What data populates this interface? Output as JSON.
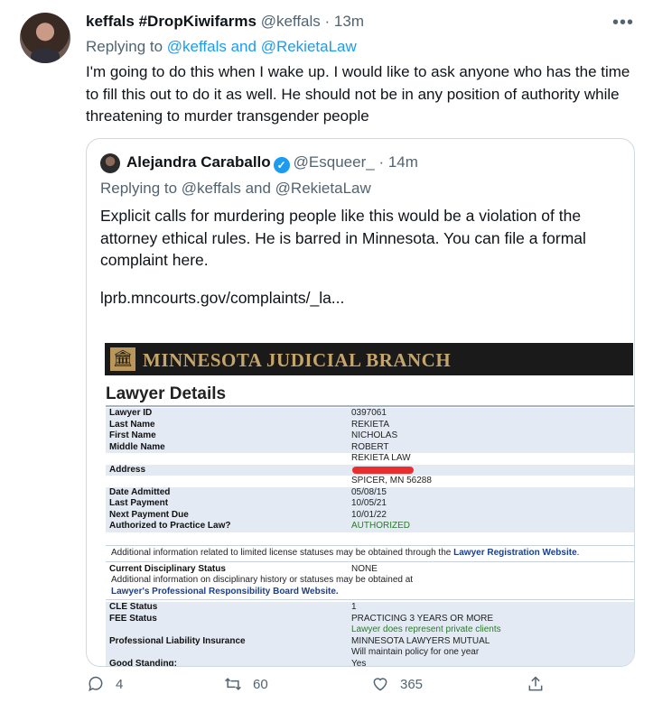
{
  "tweet": {
    "display_name": "keffals #DropKiwifarms",
    "handle": "@keffals",
    "dot": "·",
    "time": "13m",
    "replying_prefix": "Replying to",
    "replying_users": "@keffals and @RekietaLaw",
    "text": "I'm going to do this when I wake up. I would like to ask anyone who has the time to fill this out to do it as well. He should not be in any position of authority while threatening to murder transgender people",
    "more_icon": "ellipsis-icon"
  },
  "quote": {
    "display_name": "Alejandra Caraballo",
    "verified_glyph": "✓",
    "handle": "@Esqueer_",
    "dot": "·",
    "time": "14m",
    "replying": "Replying to @keffals and @RekietaLaw",
    "text": "Explicit calls for murdering people like this would be a violation of the attorney ethical rules. He is barred in Minnesota. You can file a formal complaint here.",
    "link": "lprb.mncourts.gov/complaints/_la..."
  },
  "document": {
    "banner_title": "MINNESOTA JUDICIAL BRANCH",
    "heading": "Lawyer Details",
    "rows": [
      {
        "label": "Lawyer ID",
        "value": "0397061"
      },
      {
        "label": "Last Name",
        "value": "REKIETA"
      },
      {
        "label": "First Name",
        "value": "NICHOLAS"
      },
      {
        "label": "Middle Name",
        "value": "ROBERT"
      }
    ],
    "address_label": "Address",
    "address_line1": "REKIETA LAW",
    "address_line3": "SPICER, MN  56288",
    "rows2": [
      {
        "label": "Date Admitted",
        "value": "05/08/15"
      },
      {
        "label": "Last Payment",
        "value": "10/05/21"
      },
      {
        "label": "Next Payment Due",
        "value": "10/01/22"
      }
    ],
    "authorized_label": "Authorized to Practice Law?",
    "authorized_value": "AUTHORIZED",
    "license_note_prefix": "Additional information related to limited license statuses may be obtained through the ",
    "license_note_link": "Lawyer Registration Website",
    "license_note_suffix": ".",
    "discipline_label": "Current Disciplinary Status",
    "discipline_value": "NONE",
    "discipline_note": "Additional information on disciplinary history or statuses may be obtained at",
    "discipline_link": "Lawyer's Professional Responsibility Board Website.",
    "cle_label": "CLE Status",
    "cle_value": "1",
    "fee_label": "FEE Status",
    "fee_value": "PRACTICING 3 YEARS OR MORE",
    "private_clients": "Lawyer does represent private clients",
    "insurance_label": "Professional Liability Insurance",
    "insurance_value": "MINNESOTA LAWYERS MUTUAL",
    "insurance_note": "Will maintain policy for one year",
    "standing_label": "Good Standing:",
    "standing_value": "Yes"
  },
  "actions": {
    "replies": "4",
    "retweets": "60",
    "likes": "365"
  }
}
